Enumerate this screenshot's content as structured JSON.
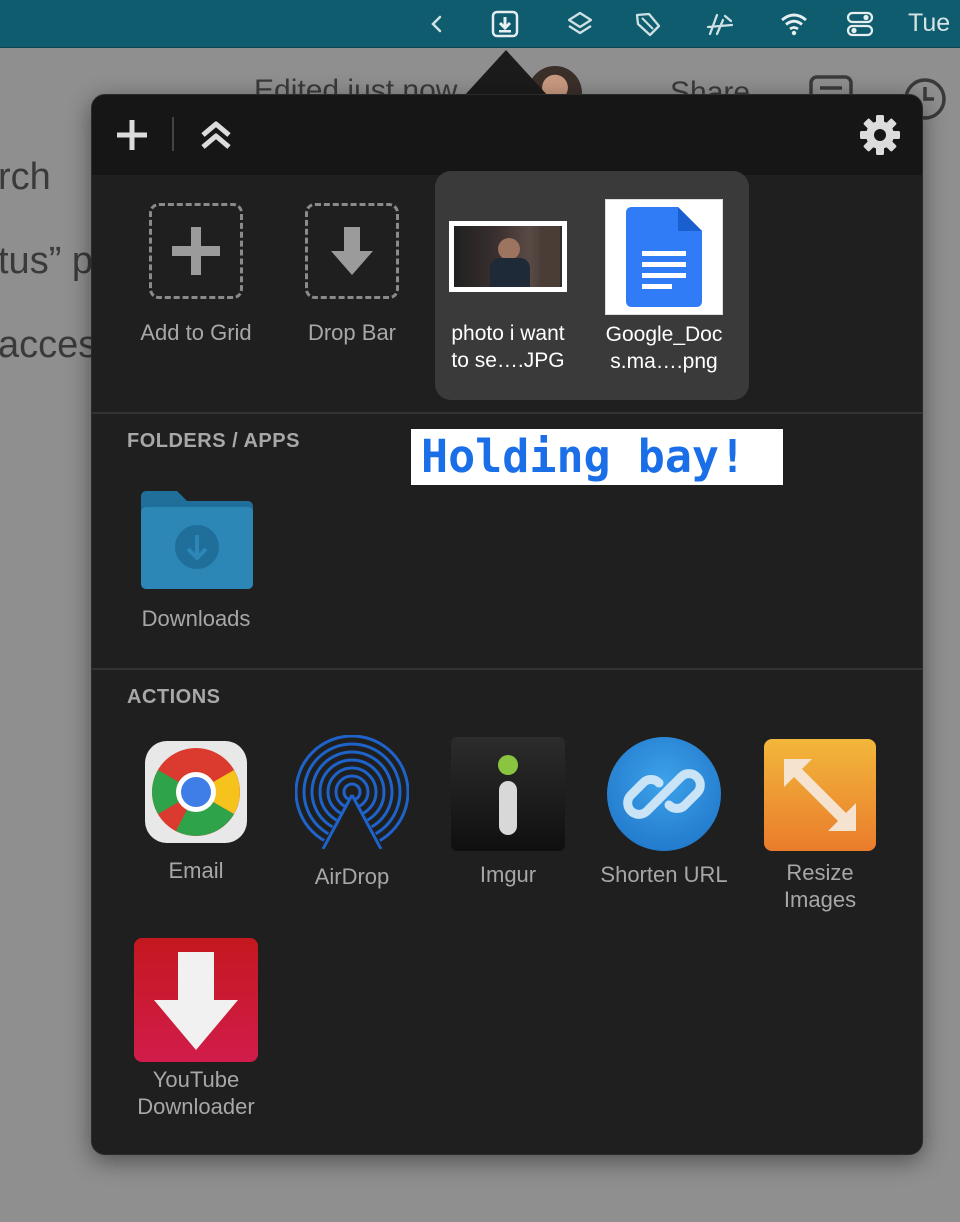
{
  "menubar": {
    "icons": [
      "chevron-left-icon",
      "dropzone-icon",
      "layers-icon",
      "tag-icon",
      "flight-icon",
      "wifi-icon",
      "control-center-icon"
    ],
    "day": "Tue"
  },
  "background_doc": {
    "status": "Edited just now",
    "share_label": "Share",
    "lines": [
      "rch",
      "tus” property",
      "access"
    ]
  },
  "toolbar": {
    "add_icon": "plus-icon",
    "collapse_icon": "double-chevron-up-icon",
    "settings_icon": "gear-icon"
  },
  "grid": {
    "add_to_grid": "Add to Grid",
    "drop_bar": "Drop Bar"
  },
  "holding_bay": {
    "files": [
      {
        "name_line1": "photo i want",
        "name_line2": "to se….JPG",
        "type": "photo"
      },
      {
        "name_line1": "Google_Doc",
        "name_line2": "s.ma….png",
        "type": "google-docs"
      }
    ]
  },
  "annotation": "Holding bay!",
  "folders_section": {
    "title": "FOLDERS / APPS",
    "items": [
      {
        "label": "Downloads"
      }
    ]
  },
  "actions_section": {
    "title": "ACTIONS",
    "items": [
      {
        "label": "Email"
      },
      {
        "label": "AirDrop"
      },
      {
        "label": "Imgur"
      },
      {
        "label": "Shorten URL"
      },
      {
        "label_line1": "Resize",
        "label_line2": "Images"
      },
      {
        "label_line1": "YouTube",
        "label_line2": "Downloader"
      }
    ]
  },
  "colors": {
    "menubar": "#0e5c6e",
    "panel": "#1f1f1f",
    "holding_bay": "#3a3a3a",
    "annotation_text": "#1a6fe8"
  }
}
